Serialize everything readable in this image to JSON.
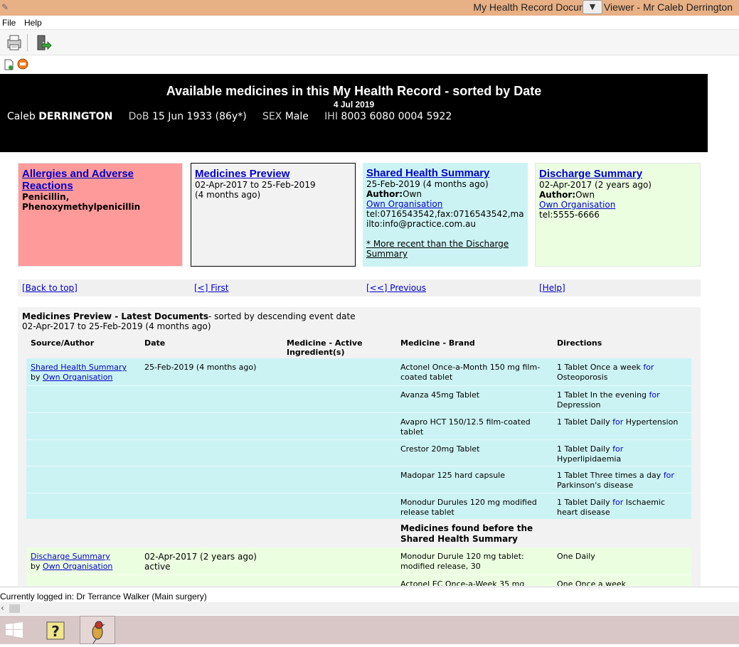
{
  "window": {
    "title": "My Health Record Document Viewer - Mr Caleb Derrington",
    "title_hidden_segment": "nt Vi",
    "menu": [
      "File",
      "Help"
    ]
  },
  "toolbar": {
    "print_icon": "printer-icon",
    "exit_icon": "exit-door-icon",
    "new_doc_icon": "new-document-icon",
    "stop_icon": "stop-icon"
  },
  "banner": {
    "heading": "Available medicines in this My Health Record - sorted by Date",
    "date": "4 Jul 2019",
    "patient_given": "Caleb",
    "patient_family": "DERRINGTON",
    "dob_label": "DoB",
    "dob_value": "15 Jun 1933 (86y*)",
    "sex_label": "SEX",
    "sex_value": "Male",
    "ihi_label": "IHI",
    "ihi_value": "8003 6080 0004 5922"
  },
  "cards": {
    "allergies": {
      "title": "Allergies and Adverse Reactions",
      "body": "Penicillin, Phenoxymethylpenicillin"
    },
    "medicines_preview": {
      "title": "Medicines Preview",
      "line1": "02-Apr-2017 to 25-Feb-2019",
      "line2": "(4 months ago)"
    },
    "shared_health_summary": {
      "title": "Shared Health Summary",
      "date": "25-Feb-2019 (4 months ago)",
      "author_label": "Author:",
      "author_value": "Own",
      "org": "Own Organisation",
      "contact": "tel:0716543542,fax:0716543542,mailto:info@practice.com.au",
      "note": "* More recent than the Discharge Summary"
    },
    "discharge_summary": {
      "title": "Discharge Summary",
      "date": "02-Apr-2017 (2 years ago)",
      "author_label": "Author:",
      "author_value": "Own",
      "org": "Own Organisation",
      "contact": "tel:5555-6666"
    }
  },
  "nav": {
    "back": "[Back to top]",
    "first": "[<] First",
    "previous": "[<<] Previous",
    "help": "[Help]"
  },
  "medicines": {
    "title_bold": "Medicines Preview - Latest Documents",
    "title_rest": "- sorted by descending event date",
    "range": "02-Apr-2017 to 25-Feb-2019 (4 months ago)",
    "columns": [
      "Source/Author",
      "Date",
      "Medicine - Active Ingredient(s)",
      "Medicine - Brand",
      "Directions"
    ],
    "shs_source": "Shared Health Summary",
    "shs_by": "by",
    "shs_org": "Own Organisation",
    "shs_date": "25-Feb-2019 (4 months ago)",
    "shs_rows": [
      {
        "brand": "Actonel Once-a-Month 150 mg film-coated tablet",
        "dir_pre": "1 Tablet Once a week ",
        "dir_for": "for",
        "dir_post": " Osteoporosis"
      },
      {
        "brand": "Avanza 45mg Tablet",
        "dir_pre": "1 Tablet In the evening ",
        "dir_for": "for",
        "dir_post": " Depression"
      },
      {
        "brand": "Avapro HCT 150/12.5 film-coated tablet",
        "dir_pre": "1 Tablet Daily ",
        "dir_for": "for",
        "dir_post": " Hypertension"
      },
      {
        "brand": "Crestor 20mg Tablet",
        "dir_pre": "1 Tablet Daily ",
        "dir_for": "for",
        "dir_post": " Hyperlipidaemia"
      },
      {
        "brand": "Madopar 125 hard capsule",
        "dir_pre": "1 Tablet Three times a day ",
        "dir_for": "for",
        "dir_post": " Parkinson's disease"
      },
      {
        "brand": "Monodur Durules 120 mg modified release tablet",
        "dir_pre": "1 Tablet Daily ",
        "dir_for": "for",
        "dir_post": " Ischaemic heart disease"
      }
    ],
    "before_heading": "Medicines found before the Shared Health Summary",
    "ds_source": "Discharge Summary",
    "ds_by": "by",
    "ds_org": "Own Organisation",
    "ds_date": "02-Apr-2017 (2 years ago)",
    "ds_status": "active",
    "ds_rows": [
      {
        "brand": "Monodur Durule 120 mg tablet: modified release, 30",
        "dir": "One Daily"
      },
      {
        "brand": "Actonel EC Once-a-Week 35 mg",
        "dir": "One Once a week"
      }
    ]
  },
  "status": {
    "logged_in": "Currently logged in:  Dr Terrance Walker (Main surgery)"
  },
  "colors": {
    "allergy_bg": "#ff9a9a",
    "shs_bg": "#ccf3f3",
    "discharge_bg": "#ebffe0",
    "link": "#0000cc",
    "banner_bg": "#000000"
  }
}
